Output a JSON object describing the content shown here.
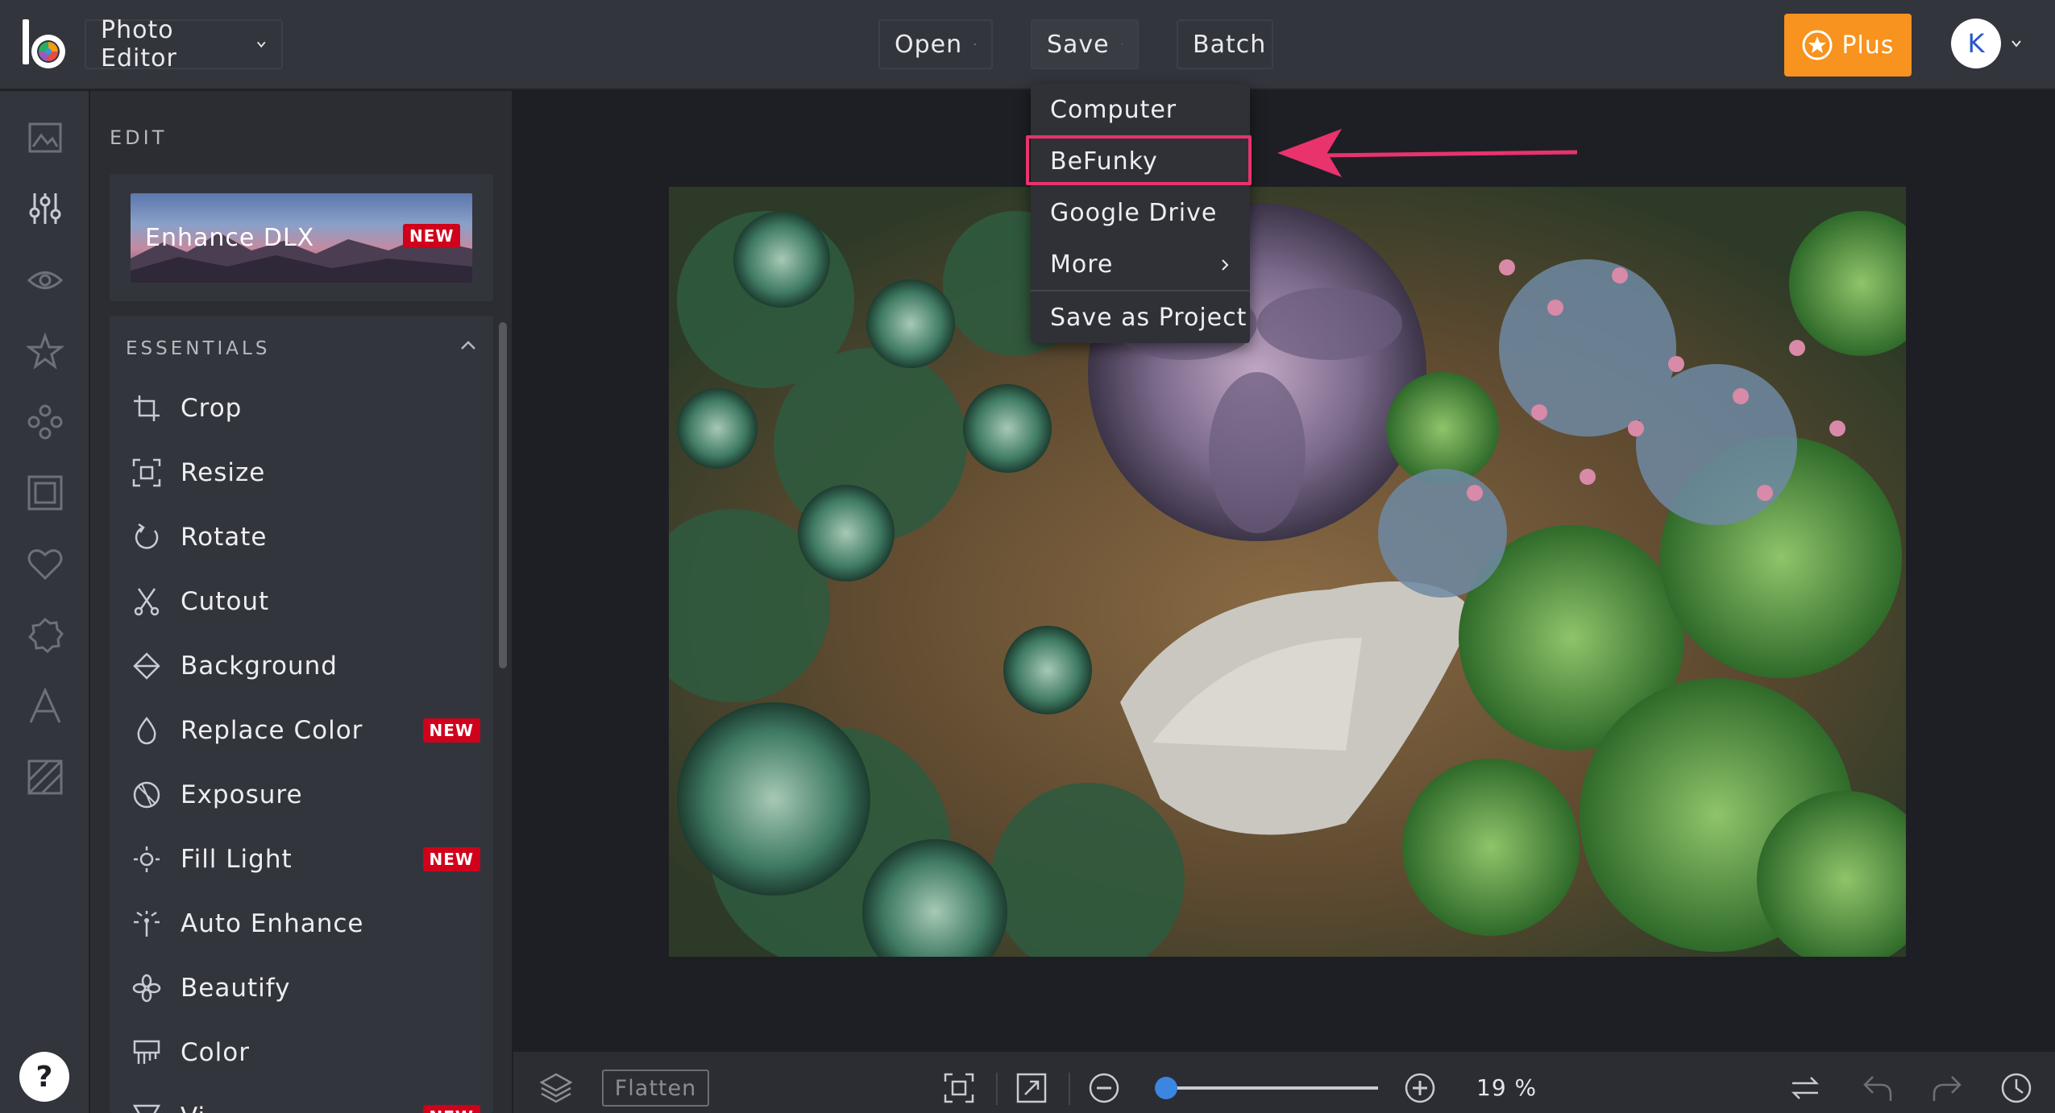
{
  "topbar": {
    "app_menu_label": "Photo Editor",
    "open_label": "Open",
    "save_label": "Save",
    "batch_label": "Batch",
    "plus_label": "Plus",
    "avatar_initial": "K",
    "brand_color": "#f7931e"
  },
  "save_menu": {
    "items": [
      {
        "label": "Computer",
        "icon": null
      },
      {
        "label": "BeFunky",
        "icon": null,
        "highlighted": true
      },
      {
        "label": "Google Drive",
        "icon": null
      },
      {
        "label": "More",
        "icon": "chevron-right-icon"
      },
      {
        "label": "Save as Project",
        "icon": null
      }
    ],
    "highlight_color": "#e8336d"
  },
  "panel": {
    "edit_heading": "EDIT",
    "enhance": {
      "label": "Enhance DLX",
      "badge": "NEW"
    },
    "essentials_heading": "ESSENTIALS",
    "tools": [
      {
        "label": "Crop",
        "icon": "crop-icon",
        "badge": ""
      },
      {
        "label": "Resize",
        "icon": "resize-icon",
        "badge": ""
      },
      {
        "label": "Rotate",
        "icon": "rotate-icon",
        "badge": ""
      },
      {
        "label": "Cutout",
        "icon": "scissors-icon",
        "badge": ""
      },
      {
        "label": "Background",
        "icon": "eraser-icon",
        "badge": ""
      },
      {
        "label": "Replace Color",
        "icon": "droplet-icon",
        "badge": "NEW"
      },
      {
        "label": "Exposure",
        "icon": "exposure-icon",
        "badge": ""
      },
      {
        "label": "Fill Light",
        "icon": "sun-icon",
        "badge": "NEW"
      },
      {
        "label": "Auto Enhance",
        "icon": "magic-wand-icon",
        "badge": ""
      },
      {
        "label": "Beautify",
        "icon": "flower-icon",
        "badge": ""
      },
      {
        "label": "Color",
        "icon": "color-swatch-icon",
        "badge": ""
      },
      {
        "label": "Vi",
        "icon": "vignette-icon",
        "badge": "NEW"
      }
    ]
  },
  "rail_icons": [
    "image-icon",
    "sliders-icon",
    "eye-icon",
    "star-icon",
    "effects-icon",
    "frame-icon",
    "heart-icon",
    "badge-icon",
    "text-icon",
    "texture-icon"
  ],
  "bottombar": {
    "flatten_label": "Flatten",
    "zoom_value": "19 %",
    "zoom_fraction": 0.04
  }
}
